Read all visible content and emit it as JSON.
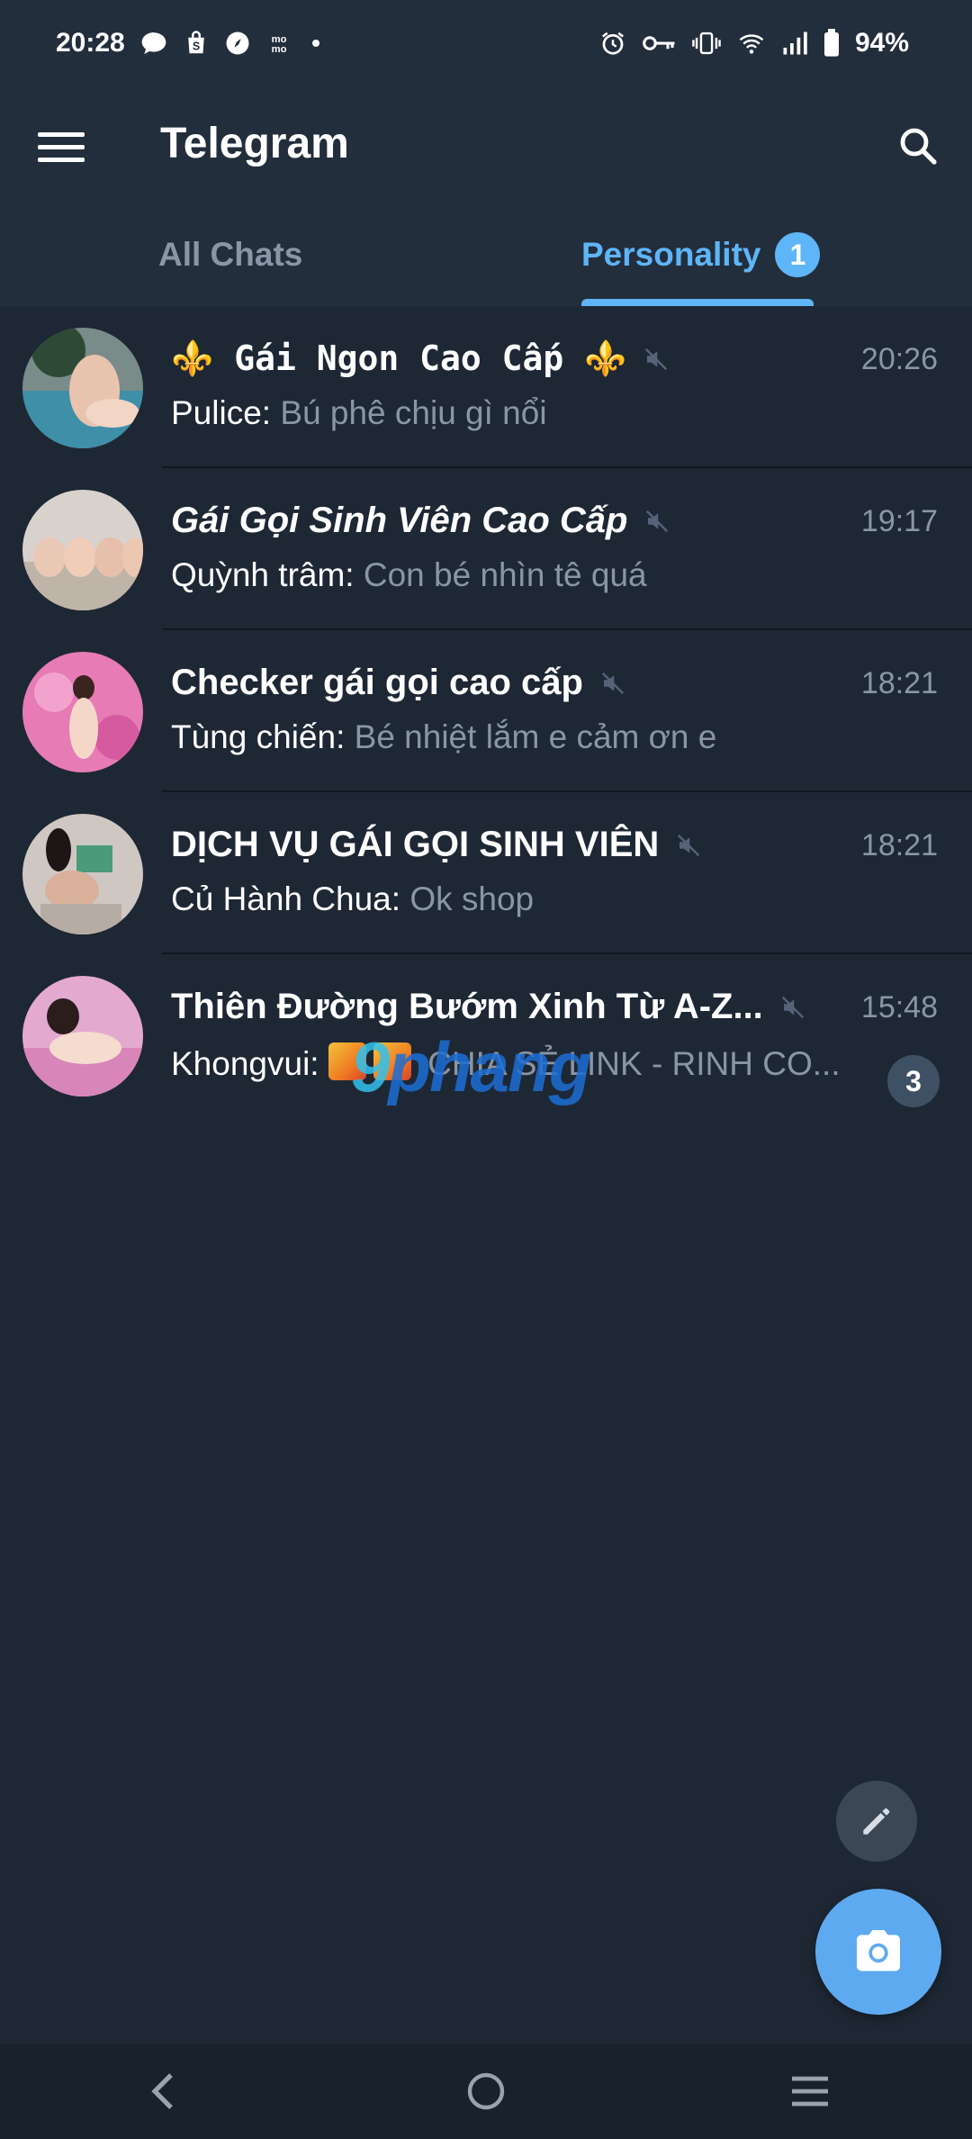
{
  "status_bar": {
    "time": "20:28",
    "battery": "94%",
    "left_icons": [
      "message-icon",
      "shop-icon",
      "compass-icon",
      "momo-icon",
      "dot-icon"
    ],
    "right_icons": [
      "alarm-icon",
      "key-icon",
      "vibrate-icon",
      "wifi-icon",
      "signal-icon",
      "battery-icon"
    ]
  },
  "app_bar": {
    "title": "Telegram"
  },
  "tabs": [
    {
      "label": "All Chats",
      "active": false
    },
    {
      "label": "Personality",
      "active": true,
      "badge": "1"
    }
  ],
  "chats": [
    {
      "name": "⚜️ Gái Ngon Cao Cấp ⚜️",
      "time": "20:26",
      "sender": "Pulice:",
      "message": "Bú phê chịu gì nổi",
      "muted": true
    },
    {
      "name": "Gái Gọi Sinh Viên Cao Cấp",
      "time": "19:17",
      "sender": "Quỳnh trâm:",
      "message": "Con bé nhìn tê quá",
      "muted": true
    },
    {
      "name": "Checker gái gọi cao cấp",
      "time": "18:21",
      "sender": "Tùng chiến:",
      "message": "Bé nhiệt lắm e cảm ơn e",
      "muted": true
    },
    {
      "name": "DỊCH VỤ GÁI GỌI SINH VIÊN",
      "time": "18:21",
      "sender": "Củ Hành Chua:",
      "message": "Ok shop",
      "muted": true
    },
    {
      "name": "Thiên Đường Bướm Xinh Từ A-Z...",
      "time": "15:48",
      "sender": "Khongvui:",
      "message": "CHIA SẺ LINK - RINH CO...",
      "muted": true,
      "unread": "3"
    }
  ],
  "watermark": {
    "text_a": "9",
    "text_b": "phang"
  },
  "colors": {
    "background": "#1e2734",
    "header": "#232e3c",
    "accent": "#5eb5f7",
    "muted_text": "#8a96a5",
    "fab": "#5eaaf0"
  }
}
